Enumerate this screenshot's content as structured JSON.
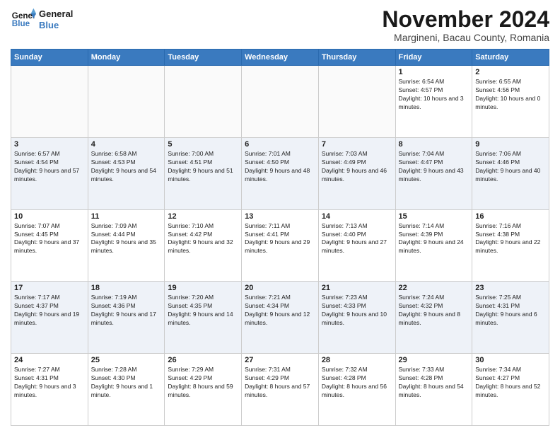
{
  "header": {
    "logo_line1": "General",
    "logo_line2": "Blue",
    "month": "November 2024",
    "location": "Margineni, Bacau County, Romania"
  },
  "weekdays": [
    "Sunday",
    "Monday",
    "Tuesday",
    "Wednesday",
    "Thursday",
    "Friday",
    "Saturday"
  ],
  "weeks": [
    [
      {
        "day": "",
        "empty": true
      },
      {
        "day": "",
        "empty": true
      },
      {
        "day": "",
        "empty": true
      },
      {
        "day": "",
        "empty": true
      },
      {
        "day": "",
        "empty": true
      },
      {
        "day": "1",
        "sunrise": "Sunrise: 6:54 AM",
        "sunset": "Sunset: 4:57 PM",
        "daylight": "Daylight: 10 hours and 3 minutes."
      },
      {
        "day": "2",
        "sunrise": "Sunrise: 6:55 AM",
        "sunset": "Sunset: 4:56 PM",
        "daylight": "Daylight: 10 hours and 0 minutes."
      }
    ],
    [
      {
        "day": "3",
        "sunrise": "Sunrise: 6:57 AM",
        "sunset": "Sunset: 4:54 PM",
        "daylight": "Daylight: 9 hours and 57 minutes."
      },
      {
        "day": "4",
        "sunrise": "Sunrise: 6:58 AM",
        "sunset": "Sunset: 4:53 PM",
        "daylight": "Daylight: 9 hours and 54 minutes."
      },
      {
        "day": "5",
        "sunrise": "Sunrise: 7:00 AM",
        "sunset": "Sunset: 4:51 PM",
        "daylight": "Daylight: 9 hours and 51 minutes."
      },
      {
        "day": "6",
        "sunrise": "Sunrise: 7:01 AM",
        "sunset": "Sunset: 4:50 PM",
        "daylight": "Daylight: 9 hours and 48 minutes."
      },
      {
        "day": "7",
        "sunrise": "Sunrise: 7:03 AM",
        "sunset": "Sunset: 4:49 PM",
        "daylight": "Daylight: 9 hours and 46 minutes."
      },
      {
        "day": "8",
        "sunrise": "Sunrise: 7:04 AM",
        "sunset": "Sunset: 4:47 PM",
        "daylight": "Daylight: 9 hours and 43 minutes."
      },
      {
        "day": "9",
        "sunrise": "Sunrise: 7:06 AM",
        "sunset": "Sunset: 4:46 PM",
        "daylight": "Daylight: 9 hours and 40 minutes."
      }
    ],
    [
      {
        "day": "10",
        "sunrise": "Sunrise: 7:07 AM",
        "sunset": "Sunset: 4:45 PM",
        "daylight": "Daylight: 9 hours and 37 minutes."
      },
      {
        "day": "11",
        "sunrise": "Sunrise: 7:09 AM",
        "sunset": "Sunset: 4:44 PM",
        "daylight": "Daylight: 9 hours and 35 minutes."
      },
      {
        "day": "12",
        "sunrise": "Sunrise: 7:10 AM",
        "sunset": "Sunset: 4:42 PM",
        "daylight": "Daylight: 9 hours and 32 minutes."
      },
      {
        "day": "13",
        "sunrise": "Sunrise: 7:11 AM",
        "sunset": "Sunset: 4:41 PM",
        "daylight": "Daylight: 9 hours and 29 minutes."
      },
      {
        "day": "14",
        "sunrise": "Sunrise: 7:13 AM",
        "sunset": "Sunset: 4:40 PM",
        "daylight": "Daylight: 9 hours and 27 minutes."
      },
      {
        "day": "15",
        "sunrise": "Sunrise: 7:14 AM",
        "sunset": "Sunset: 4:39 PM",
        "daylight": "Daylight: 9 hours and 24 minutes."
      },
      {
        "day": "16",
        "sunrise": "Sunrise: 7:16 AM",
        "sunset": "Sunset: 4:38 PM",
        "daylight": "Daylight: 9 hours and 22 minutes."
      }
    ],
    [
      {
        "day": "17",
        "sunrise": "Sunrise: 7:17 AM",
        "sunset": "Sunset: 4:37 PM",
        "daylight": "Daylight: 9 hours and 19 minutes."
      },
      {
        "day": "18",
        "sunrise": "Sunrise: 7:19 AM",
        "sunset": "Sunset: 4:36 PM",
        "daylight": "Daylight: 9 hours and 17 minutes."
      },
      {
        "day": "19",
        "sunrise": "Sunrise: 7:20 AM",
        "sunset": "Sunset: 4:35 PM",
        "daylight": "Daylight: 9 hours and 14 minutes."
      },
      {
        "day": "20",
        "sunrise": "Sunrise: 7:21 AM",
        "sunset": "Sunset: 4:34 PM",
        "daylight": "Daylight: 9 hours and 12 minutes."
      },
      {
        "day": "21",
        "sunrise": "Sunrise: 7:23 AM",
        "sunset": "Sunset: 4:33 PM",
        "daylight": "Daylight: 9 hours and 10 minutes."
      },
      {
        "day": "22",
        "sunrise": "Sunrise: 7:24 AM",
        "sunset": "Sunset: 4:32 PM",
        "daylight": "Daylight: 9 hours and 8 minutes."
      },
      {
        "day": "23",
        "sunrise": "Sunrise: 7:25 AM",
        "sunset": "Sunset: 4:31 PM",
        "daylight": "Daylight: 9 hours and 6 minutes."
      }
    ],
    [
      {
        "day": "24",
        "sunrise": "Sunrise: 7:27 AM",
        "sunset": "Sunset: 4:31 PM",
        "daylight": "Daylight: 9 hours and 3 minutes."
      },
      {
        "day": "25",
        "sunrise": "Sunrise: 7:28 AM",
        "sunset": "Sunset: 4:30 PM",
        "daylight": "Daylight: 9 hours and 1 minute."
      },
      {
        "day": "26",
        "sunrise": "Sunrise: 7:29 AM",
        "sunset": "Sunset: 4:29 PM",
        "daylight": "Daylight: 8 hours and 59 minutes."
      },
      {
        "day": "27",
        "sunrise": "Sunrise: 7:31 AM",
        "sunset": "Sunset: 4:29 PM",
        "daylight": "Daylight: 8 hours and 57 minutes."
      },
      {
        "day": "28",
        "sunrise": "Sunrise: 7:32 AM",
        "sunset": "Sunset: 4:28 PM",
        "daylight": "Daylight: 8 hours and 56 minutes."
      },
      {
        "day": "29",
        "sunrise": "Sunrise: 7:33 AM",
        "sunset": "Sunset: 4:28 PM",
        "daylight": "Daylight: 8 hours and 54 minutes."
      },
      {
        "day": "30",
        "sunrise": "Sunrise: 7:34 AM",
        "sunset": "Sunset: 4:27 PM",
        "daylight": "Daylight: 8 hours and 52 minutes."
      }
    ]
  ]
}
